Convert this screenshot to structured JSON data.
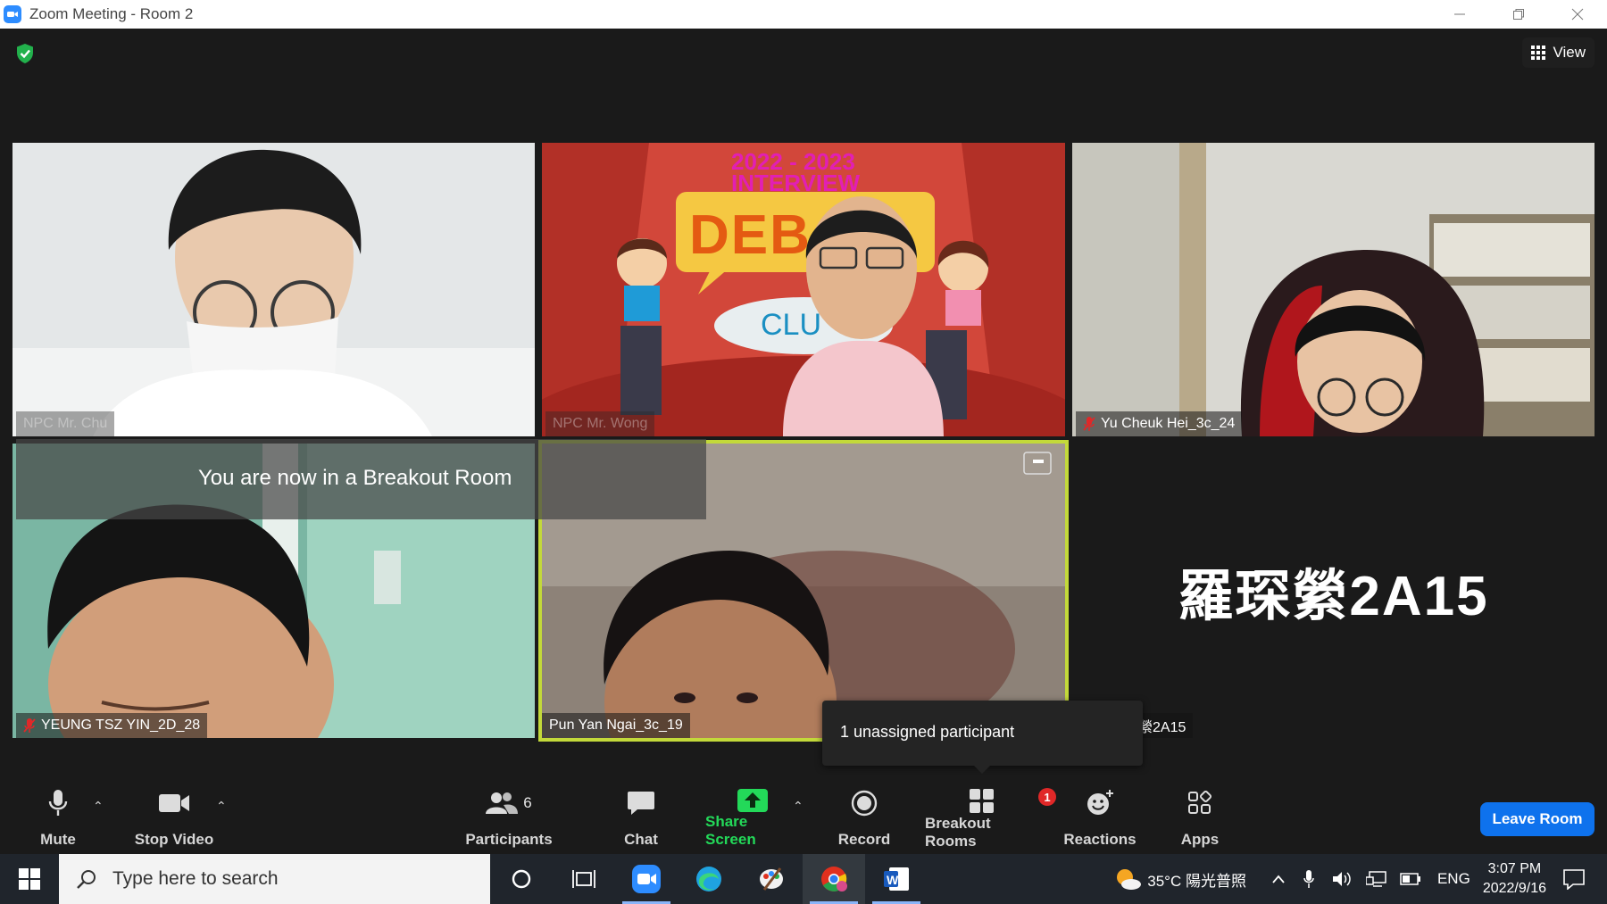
{
  "window": {
    "title": "Zoom Meeting - Room 2",
    "controls": [
      "minimize",
      "restore",
      "close"
    ]
  },
  "header": {
    "security_icon": "shield-check-icon",
    "view_label": "View"
  },
  "tiles": [
    {
      "id": "npc-chu",
      "name": "NPC Mr. Chu",
      "muted": false,
      "bg": "#e6e9ea"
    },
    {
      "id": "npc-wong",
      "name": "NPC Mr. Wong",
      "muted": false,
      "bg": "#c83a3a"
    },
    {
      "id": "yu-cheuk",
      "name": "Yu Cheuk Hei_3c_24",
      "muted": true,
      "bg": "#dcdcd8"
    },
    {
      "id": "yeung",
      "name": "YEUNG TSZ YIN_2D_28",
      "muted": true,
      "bg": "#9fcfbf"
    },
    {
      "id": "pun",
      "name": "Pun Yan Ngai_3c_19",
      "muted": false,
      "bg": "#8a7f75",
      "active_speaker": true
    },
    {
      "id": "lo",
      "name": "羅琛縈2A15",
      "label_visible": "縈2A15",
      "muted": false,
      "bg": "#1a1a1a"
    }
  ],
  "virtual_bg": {
    "year": "2022 - 2023",
    "line2": "INTERVIEW",
    "debate": "DEB",
    "club": "CLU"
  },
  "banner": {
    "text": "You are now in a Breakout Room"
  },
  "tooltip": {
    "text": "1 unassigned participant"
  },
  "toolbar": {
    "mute": "Mute",
    "stop_video": "Stop Video",
    "participants": "Participants",
    "participants_count": "6",
    "chat": "Chat",
    "share_screen": "Share Screen",
    "record": "Record",
    "breakout_rooms": "Breakout Rooms",
    "breakout_badge": "1",
    "reactions": "Reactions",
    "apps": "Apps",
    "leave": "Leave Room"
  },
  "taskbar": {
    "search_placeholder": "Type here to search",
    "weather": "35°C 陽光普照",
    "lang": "ENG",
    "time": "3:07 PM",
    "date": "2022/9/16"
  }
}
